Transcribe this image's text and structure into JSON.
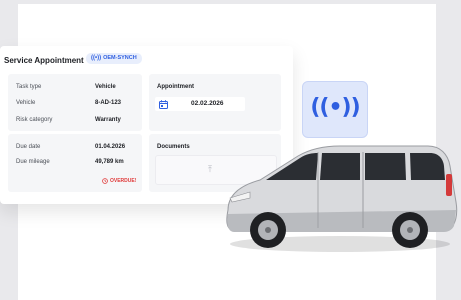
{
  "header": {
    "title": "Service Appointment",
    "badge_label": "OEM-SYNCH",
    "badge_icon": "broadcast-icon"
  },
  "vehicle_panel": {
    "rows": [
      {
        "label": "Task type",
        "value": "Vehicle"
      },
      {
        "label": "Vehicle",
        "value": "8-AD-123"
      },
      {
        "label": "Risk category",
        "value": "Warranty"
      }
    ]
  },
  "appointment_panel": {
    "title": "Appointment",
    "date": "02.02.2026",
    "icon": "calendar-icon"
  },
  "due_panel": {
    "rows": [
      {
        "label": "Due date",
        "value": "01.04.2026"
      },
      {
        "label": "Due mileage",
        "value": "49,789 km"
      }
    ],
    "status": "OVERDUE!",
    "status_icon": "clock-icon"
  },
  "documents_panel": {
    "title": "Documents",
    "upload_icon": "upload-icon"
  },
  "signal_tile": {
    "glyph": "((•))",
    "icon": "broadcast-signal-icon"
  },
  "colors": {
    "accent": "#2f5fe0",
    "badge_bg": "#e8eefc",
    "overdue": "#e03a3a"
  }
}
